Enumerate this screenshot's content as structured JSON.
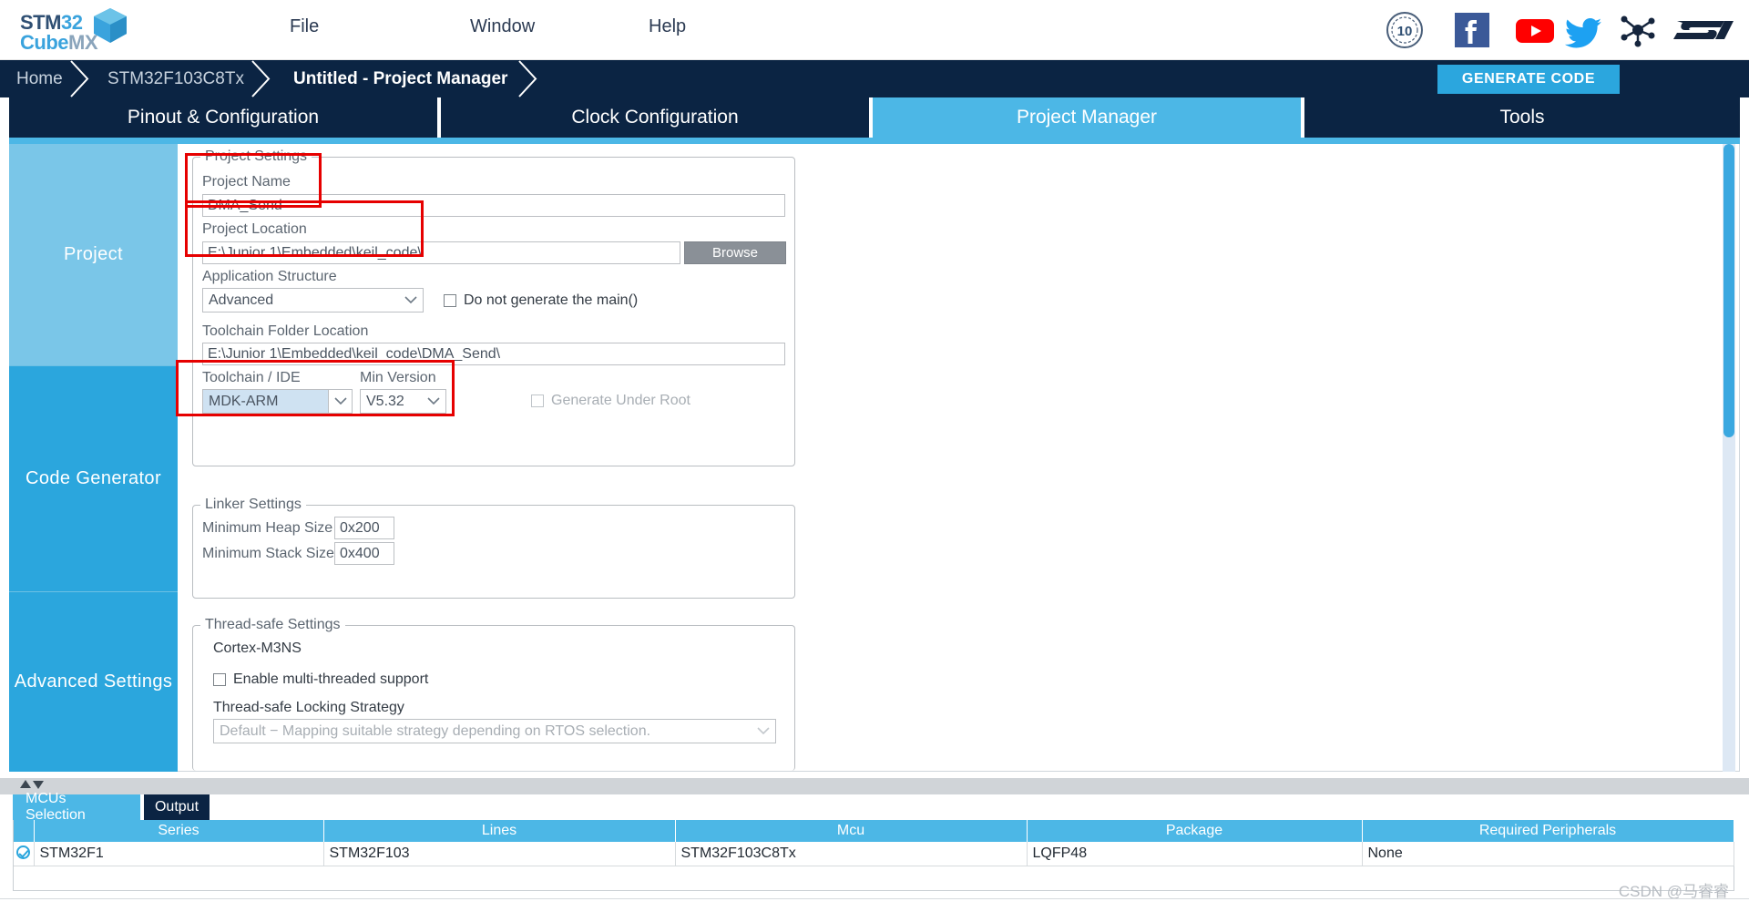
{
  "app": {
    "logo_line1": "STM32",
    "logo_line1_accent": "32",
    "logo_line2": "Cube",
    "logo_line2_suffix": "MX"
  },
  "menu": {
    "file": "File",
    "window": "Window",
    "help": "Help"
  },
  "social_icons": [
    {
      "name": "ten-years-badge-icon",
      "label": "10"
    },
    {
      "name": "facebook-icon",
      "label": "Facebook"
    },
    {
      "name": "youtube-icon",
      "label": "YouTube"
    },
    {
      "name": "twitter-icon",
      "label": "Twitter"
    },
    {
      "name": "community-network-icon",
      "label": "Community"
    },
    {
      "name": "st-logo-icon",
      "label": "ST"
    }
  ],
  "breadcrumb": {
    "home": "Home",
    "mcu": "STM32F103C8Tx",
    "current": "Untitled - Project Manager",
    "generate_button": "GENERATE CODE"
  },
  "main_tabs": [
    {
      "label": "Pinout & Configuration",
      "selected": false
    },
    {
      "label": "Clock Configuration",
      "selected": false
    },
    {
      "label": "Project Manager",
      "selected": true
    },
    {
      "label": "Tools",
      "selected": false
    }
  ],
  "sidebar": {
    "items": [
      {
        "label": "Project",
        "selected": true
      },
      {
        "label": "Code Generator",
        "selected": false
      },
      {
        "label": "Advanced Settings",
        "selected": false
      }
    ]
  },
  "project_settings": {
    "legend": "Project Settings",
    "project_name_label": "Project Name",
    "project_name_value": "DMA_Send",
    "project_location_label": "Project Location",
    "project_location_value": "E:\\Junior 1\\Embedded\\keil_code\\",
    "browse_button": "Browse",
    "application_structure_label": "Application Structure",
    "application_structure_value": "Advanced",
    "do_not_generate_main_label": "Do not generate the main()",
    "do_not_generate_main_checked": false,
    "toolchain_folder_label": "Toolchain Folder Location",
    "toolchain_folder_value": "E:\\Junior 1\\Embedded\\keil_code\\DMA_Send\\",
    "toolchain_ide_label": "Toolchain / IDE",
    "toolchain_ide_value": "MDK-ARM",
    "min_version_label": "Min Version",
    "min_version_value": "V5.32",
    "generate_under_root_label": "Generate Under Root",
    "generate_under_root_checked": false
  },
  "linker_settings": {
    "legend": "Linker Settings",
    "min_heap_label": "Minimum Heap Size",
    "min_heap_value": "0x200",
    "min_stack_label": "Minimum Stack Size",
    "min_stack_value": "0x400"
  },
  "thread_safe_settings": {
    "legend": "Thread-safe Settings",
    "core_label": "Cortex-M3NS",
    "enable_multithread_label": "Enable multi-threaded support",
    "enable_multithread_checked": false,
    "locking_strategy_label": "Thread-safe Locking Strategy",
    "locking_strategy_value": "Default  −  Mapping suitable strategy depending on RTOS selection."
  },
  "bottom_tabs": [
    {
      "label": "MCUs Selection",
      "selected": true
    },
    {
      "label": "Output",
      "selected": false
    }
  ],
  "mcu_table": {
    "columns": [
      "",
      "Series",
      "Lines",
      "Mcu",
      "Package",
      "Required Peripherals"
    ],
    "rows": [
      {
        "selected": true,
        "series": "STM32F1",
        "lines": "STM32F103",
        "mcu": "STM32F103C8Tx",
        "package": "LQFP48",
        "required_peripherals": "None"
      }
    ]
  },
  "watermark": "CSDN @马睿睿",
  "colors": {
    "dark_navy": "#0b2443",
    "accent_blue": "#2ba6de",
    "tab_selected": "#4cb7e6",
    "sidebar_selected": "#7ac6e8",
    "sidebar_normal": "#2ba6dd",
    "highlight_red": "#e60000"
  }
}
